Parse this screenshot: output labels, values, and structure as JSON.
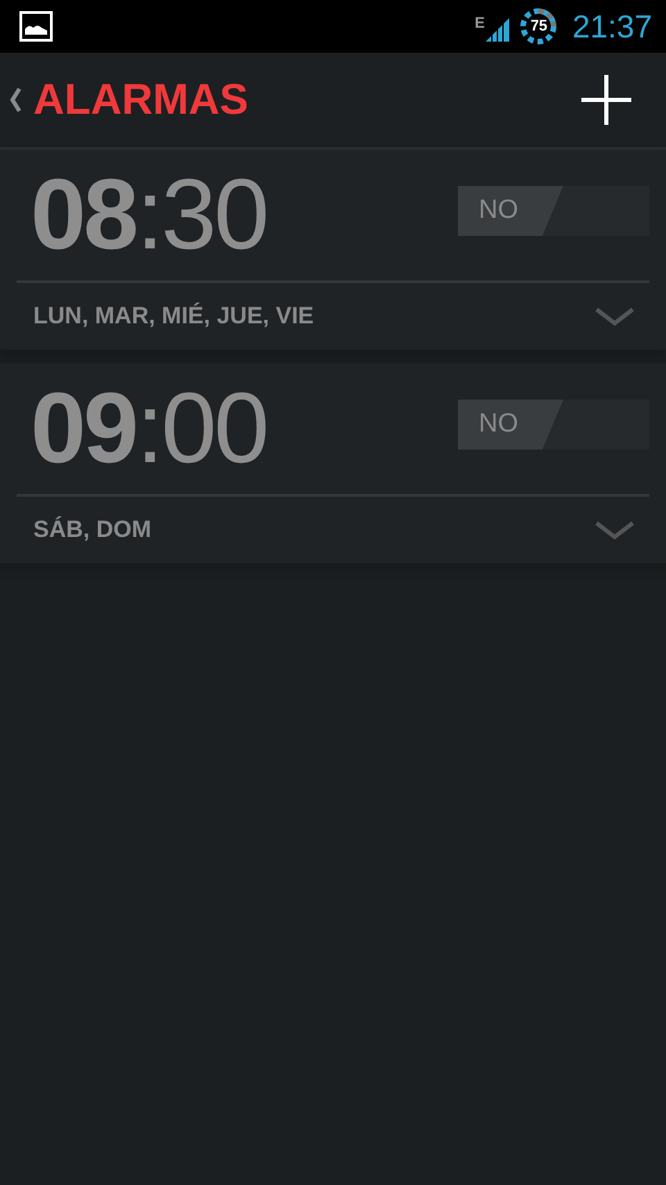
{
  "status_bar": {
    "network": "E",
    "battery": "75",
    "time": "21:37"
  },
  "action_bar": {
    "title": "ALARMAS"
  },
  "alarms": [
    {
      "time": "**08**:30",
      "switch": {
        "label": "NO",
        "on": false
      },
      "days": "LUN, MAR, MIÉ, JUE, VIE",
      "expanded": false
    },
    {
      "time": "**09**:00",
      "switch": {
        "label": "NO",
        "on": false
      },
      "days": "SÁB, DOM",
      "expanded": false
    }
  ]
}
